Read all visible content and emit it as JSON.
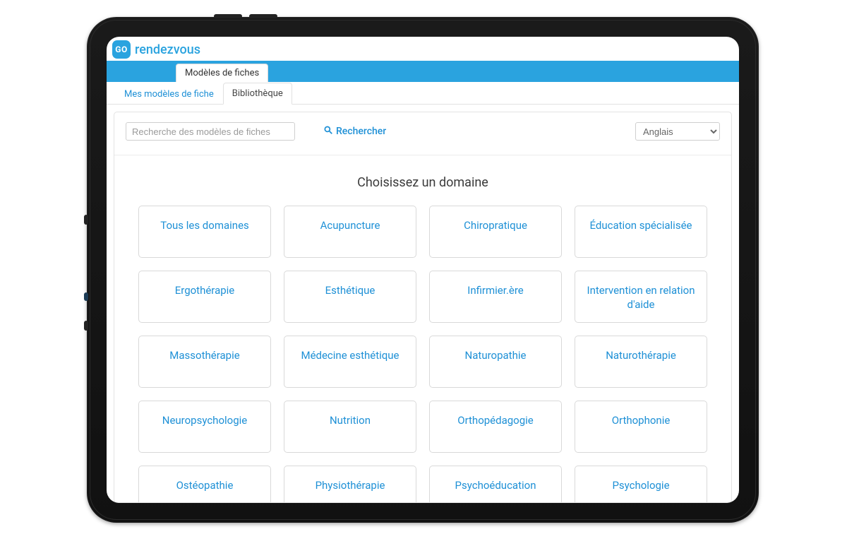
{
  "brand": {
    "badge": "GO",
    "name": "rendezvous"
  },
  "nav": {
    "main_tab": "Modèles de fiches"
  },
  "subtabs": {
    "mes_modeles": "Mes modèles de fiche",
    "bibliotheque": "Bibliothèque"
  },
  "toolbar": {
    "search_placeholder": "Recherche des modèles de fiches",
    "search_button": "Rechercher",
    "language_selected": "Anglais"
  },
  "section_title": "Choisissez un domaine",
  "domains": [
    "Tous les domaines",
    "Acupuncture",
    "Chiropratique",
    "Éducation spécialisée",
    "Ergothérapie",
    "Esthétique",
    "Infirmier.ère",
    "Intervention en relation d'aide",
    "Massothérapie",
    "Médecine esthétique",
    "Naturopathie",
    "Naturothérapie",
    "Neuropsychologie",
    "Nutrition",
    "Orthopédagogie",
    "Orthophonie",
    "Ostéopathie",
    "Physiothérapie",
    "Psychoéducation",
    "Psychologie"
  ]
}
